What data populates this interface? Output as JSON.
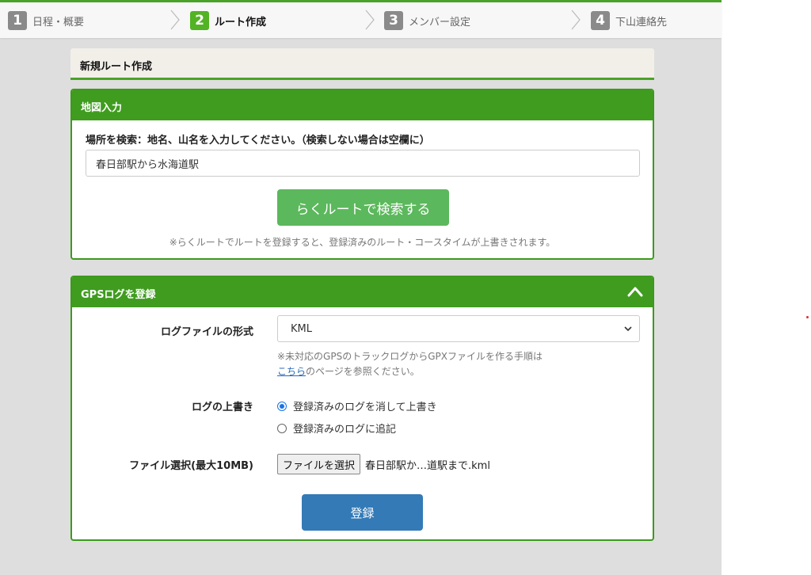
{
  "steps": [
    {
      "num": "1",
      "label": "日程・概要",
      "active": false
    },
    {
      "num": "2",
      "label": "ルート作成",
      "active": true
    },
    {
      "num": "3",
      "label": "メンバー設定",
      "active": false
    },
    {
      "num": "4",
      "label": "下山連絡先",
      "active": false
    }
  ],
  "page_title": "新規ルート作成",
  "map_panel": {
    "title": "地図入力",
    "search_label": "場所を検索：地名、山名を入力してください。（検索しない場合は空欄に）",
    "search_value": "春日部駅から水海道駅",
    "search_button": "らくルートで検索する",
    "note": "※らくルートでルートを登録すると、登録済みのルート・コースタイムが上書きされます。"
  },
  "gps_panel": {
    "title": "GPSログを登録",
    "format_label": "ログファイルの形式",
    "format_value": "KML",
    "help_line1": "※未対応のGPSのトラックログからGPXファイルを作る手順は",
    "help_link": "こちら",
    "help_line2_suffix": "のページを参照ください。",
    "overwrite_label": "ログの上書き",
    "overwrite_options": [
      "登録済みのログを消して上書き",
      "登録済みのログに追記"
    ],
    "overwrite_selected": 0,
    "file_label": "ファイル選択(最大10MB)",
    "file_button": "ファイルを選択",
    "file_name": "春日部駅か…道駅まで.kml",
    "submit_button": "登録"
  },
  "colors": {
    "accent_green": "#3f9c1f",
    "button_green": "#5cb85c",
    "button_blue": "#337ab7"
  }
}
